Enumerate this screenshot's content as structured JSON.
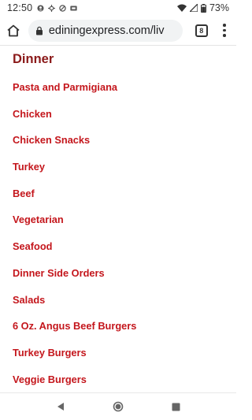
{
  "status_bar": {
    "time": "12:50",
    "battery": "73%",
    "left_icons": [
      "account-icon",
      "crosshair-icon",
      "circle-slash-icon",
      "sim-icon"
    ],
    "right_icons": [
      "wifi-icon",
      "signal-icon",
      "battery-icon"
    ]
  },
  "browser": {
    "url": "ediningexpress.com/liv",
    "tab_count": "8"
  },
  "page": {
    "section_title": "Dinner",
    "items": [
      "Pasta and Parmigiana",
      "Chicken",
      "Chicken Snacks",
      "Turkey",
      "Beef",
      "Vegetarian",
      "Seafood",
      "Dinner Side Orders",
      "Salads",
      "6 Oz. Angus Beef Burgers",
      "Turkey Burgers",
      "Veggie Burgers"
    ]
  },
  "colors": {
    "title": "#8b1a1a",
    "link": "#c4161c",
    "omnibox_bg": "#f1f3f4"
  }
}
